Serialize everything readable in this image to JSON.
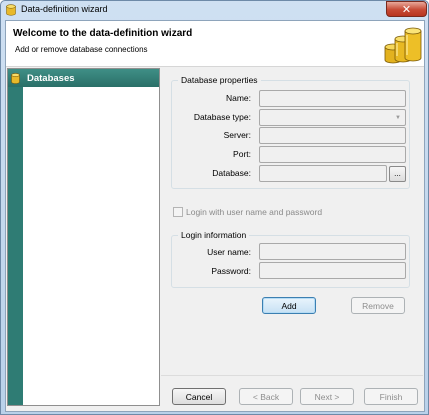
{
  "window": {
    "title": "Data-definition wizard",
    "close_glyph": "✕",
    "app_icon": "database-icon"
  },
  "header": {
    "title": "Welcome to the data-definition wizard",
    "subtitle": "Add or remove database connections",
    "icon": "database-stack-icon"
  },
  "sidebar": {
    "items": [
      {
        "label": "Databases",
        "icon": "database-icon",
        "selected": true
      }
    ]
  },
  "database_properties": {
    "group_title": "Database properties",
    "fields": [
      {
        "label": "Name:",
        "value": ""
      },
      {
        "label": "Database type:",
        "value": ""
      },
      {
        "label": "Server:",
        "value": ""
      },
      {
        "label": "Port:",
        "value": ""
      },
      {
        "label": "Database:",
        "value": ""
      }
    ],
    "browse_label": "..."
  },
  "login": {
    "checkbox_label": "Login with user name and password",
    "checked": false,
    "group_title": "Login information",
    "fields": [
      {
        "label": "User name:",
        "value": ""
      },
      {
        "label": "Password:",
        "value": ""
      }
    ]
  },
  "actions": {
    "add_label": "Add",
    "remove_label": "Remove"
  },
  "footer": {
    "cancel_label": "Cancel",
    "back_label": "< Back",
    "next_label": "Next >",
    "finish_label": "Finish"
  },
  "colors": {
    "sidebar_accent": "#2f7c74",
    "title_bar": "#c4d8ee",
    "close_button": "#c74a35",
    "default_button_border": "#3c7fb1"
  }
}
